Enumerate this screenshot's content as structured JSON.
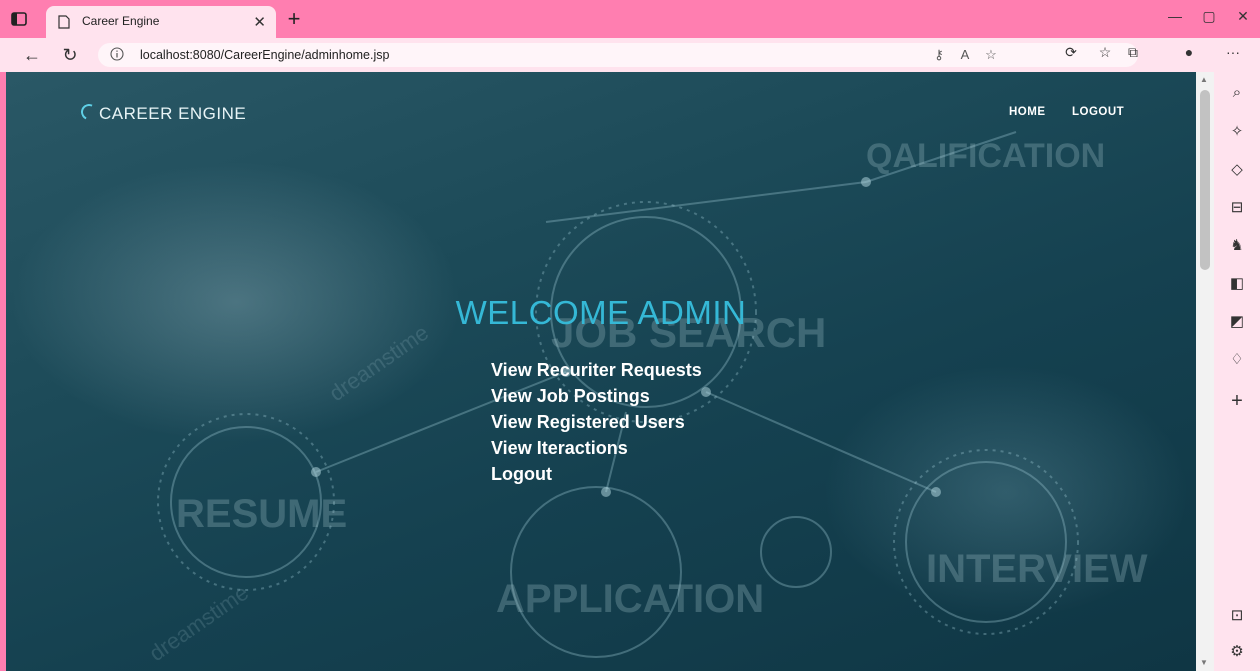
{
  "browser": {
    "tab_title": "Career Engine",
    "new_tab_label": "+",
    "url": "localhost:8080/CareerEngine/adminhome.jsp",
    "window_controls": [
      "—",
      "▢",
      "✕"
    ],
    "more_label": "···"
  },
  "site": {
    "brand": "CAREER ENGINE",
    "nav": [
      "HOME",
      "LOGOUT"
    ]
  },
  "main": {
    "welcome": "WELCOME ADMIN",
    "links": [
      "View Recuriter Requests",
      "View Job Postings",
      "View Registered Users",
      "View Iteractions",
      "Logout"
    ]
  },
  "background_text": [
    "QALIFICATION",
    "JOB SEARCH",
    "RESUME",
    "APPLICATION",
    "INTERVIEW",
    "dreamstime"
  ],
  "colors": {
    "chrome": "#ff7eb0",
    "welcome": "#35b8d6",
    "overlay": "#154150"
  },
  "icons": [
    "back-icon",
    "refresh-icon",
    "info-icon",
    "key-icon",
    "read-aloud-icon",
    "favorite-add-icon",
    "extensions-icon",
    "favorites-icon",
    "collections-icon",
    "profile-icon",
    "search-icon",
    "sparkle-icon",
    "tag-icon",
    "briefcase-icon",
    "games-icon",
    "office-icon",
    "outlook-icon",
    "bell-icon",
    "add-icon",
    "sidebar-toggle-icon",
    "settings-icon"
  ]
}
